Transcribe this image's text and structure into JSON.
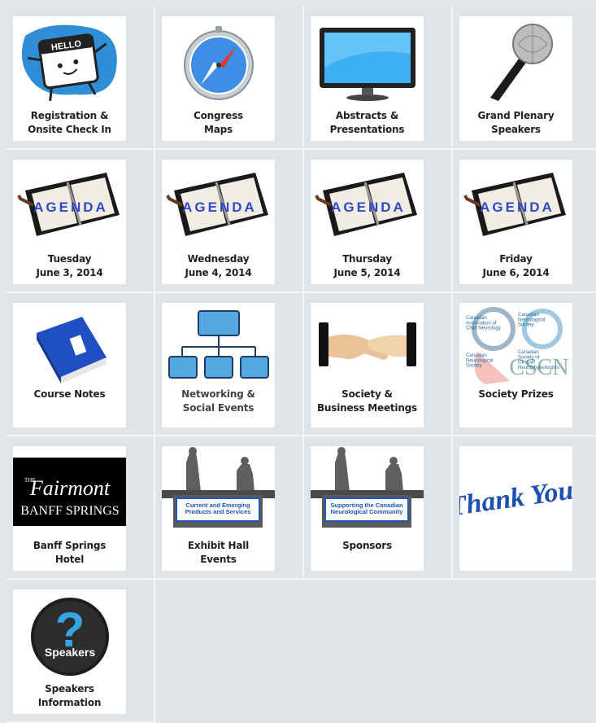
{
  "tiles": [
    {
      "name": "registration-tile",
      "label": "Registration &\nOnsite Check In",
      "icon": "hello-name-tag-icon",
      "badge": "HELLO"
    },
    {
      "name": "congress-maps-tile",
      "label": "Congress\nMaps",
      "icon": "compass-icon"
    },
    {
      "name": "abstracts-tile",
      "label": "Abstracts &\nPresentations",
      "icon": "monitor-icon"
    },
    {
      "name": "plenary-speakers-tile",
      "label": "Grand Plenary\nSpeakers",
      "icon": "microphone-icon"
    },
    {
      "name": "agenda-tuesday-tile",
      "label": "Tuesday\nJune 3, 2014",
      "icon": "agenda-planner-icon",
      "badge": "AGENDA"
    },
    {
      "name": "agenda-wednesday-tile",
      "label": "Wednesday\nJune 4, 2014",
      "icon": "agenda-planner-icon",
      "badge": "AGENDA"
    },
    {
      "name": "agenda-thursday-tile",
      "label": "Thursday\nJune 5, 2014",
      "icon": "agenda-planner-icon",
      "badge": "AGENDA"
    },
    {
      "name": "agenda-friday-tile",
      "label": "Friday\nJune 6, 2014",
      "icon": "agenda-planner-icon",
      "badge": "AGENDA"
    },
    {
      "name": "course-notes-tile",
      "label": "Course Notes",
      "icon": "blue-binder-icon"
    },
    {
      "name": "networking-tile",
      "label": "Networking &\nSocial Events",
      "icon": "org-chart-icon"
    },
    {
      "name": "society-meetings-tile",
      "label": "Society &\nBusiness Meetings",
      "icon": "handshake-icon"
    },
    {
      "name": "society-prizes-tile",
      "label": "Society Prizes",
      "icon": "society-logos-collage-icon",
      "collage": {
        "a": "Canadian\nAssociation of\nChild Neurology",
        "b": "Canadian\nNeurological\nSociety",
        "c": "Canadian\nNeurological\nSociety",
        "d": "Canadian\nSociety of\nClinical\nNeurophysiologists",
        "e": "CSCN"
      }
    },
    {
      "name": "banff-springs-tile",
      "label": "Banff Springs\nHotel",
      "icon": "fairmont-logo-icon",
      "logo": {
        "the": "THE",
        "brand": "Fairmont",
        "sub": "BANFF SPRINGS"
      }
    },
    {
      "name": "exhibit-hall-tile",
      "label": "Exhibit Hall\nEvents",
      "icon": "exhibit-booth-icon",
      "banner": "Current and Emerging\nProducts and Services"
    },
    {
      "name": "sponsors-tile",
      "label": "Sponsors",
      "icon": "exhibit-booth-icon",
      "banner": "Supporting the Canadian\nNeurological Community"
    },
    {
      "name": "thank-you-tile",
      "label": "",
      "icon": "thank-you-script-icon",
      "script": "Thank You!"
    },
    {
      "name": "speakers-info-tile",
      "label": "Speakers\nInformation",
      "icon": "question-speakers-icon",
      "badge": "Speakers"
    }
  ],
  "colors": {
    "agenda_text": "#2f49c8",
    "binder": "#1f4fc2",
    "chart_box": "#55a9e3",
    "fairmont_bg": "#000000",
    "thank_you": "#1b4fb0"
  }
}
